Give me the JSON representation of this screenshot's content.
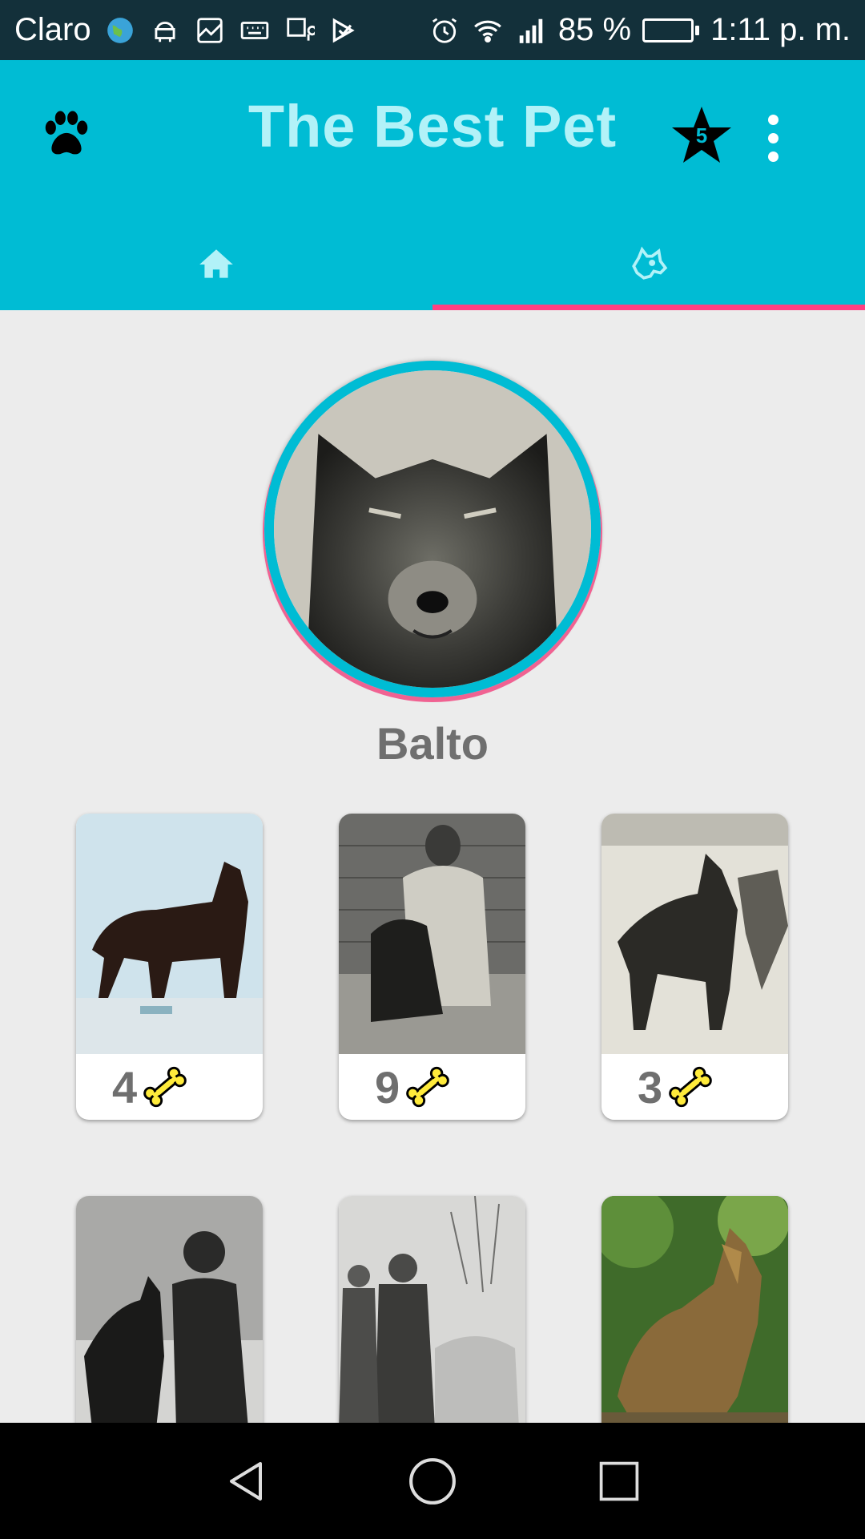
{
  "status_bar": {
    "carrier": "Claro",
    "battery_percent": "85 %",
    "battery_level": 0.85,
    "time": "1:11 p. m.",
    "icons": [
      "globe-icon",
      "android-icon",
      "image-icon",
      "keyboard-icon",
      "maps-icon",
      "check-icon",
      "alarm-icon",
      "wifi-icon",
      "signal-icon",
      "battery-charging-icon"
    ]
  },
  "app_bar": {
    "title": "The Best Pet",
    "star_count": "5",
    "accent_color": "#00bcd4",
    "indicator_color": "#ff4081"
  },
  "tabs": [
    {
      "icon": "home-icon",
      "selected": false
    },
    {
      "icon": "dog-head-icon",
      "selected": true
    }
  ],
  "profile": {
    "name": "Balto"
  },
  "photos": [
    {
      "likes": "4",
      "subject": "balto-mounted-exhibit"
    },
    {
      "likes": "9",
      "subject": "balto-with-musher"
    },
    {
      "likes": "3",
      "subject": "balto-in-snow"
    },
    {
      "likes": "",
      "subject": "balto-with-child"
    },
    {
      "likes": "",
      "subject": "men-in-coats"
    },
    {
      "likes": "",
      "subject": "balto-statue"
    }
  ],
  "nav_bar": {
    "buttons": [
      "back-icon",
      "home-circle-icon",
      "recents-icon"
    ]
  }
}
